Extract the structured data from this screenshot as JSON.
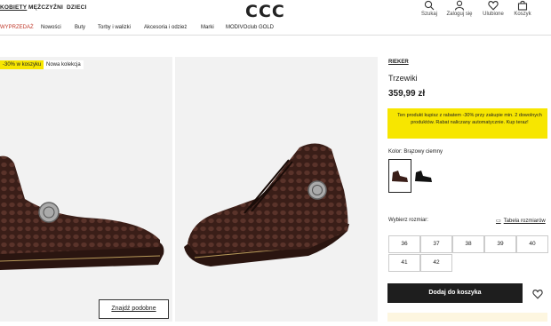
{
  "header": {
    "gender_tabs": [
      "KOBIETY",
      "MĘŻCZYŹNI",
      "DZIECI"
    ],
    "logo": "CCC",
    "tools": [
      {
        "label": "Szukaj",
        "icon": "search-icon"
      },
      {
        "label": "Zaloguj się",
        "icon": "user-icon"
      },
      {
        "label": "Ulubione",
        "icon": "heart-icon"
      },
      {
        "label": "Koszyk",
        "icon": "bag-icon"
      }
    ]
  },
  "nav": {
    "items": [
      "WYPRZEDAŻ",
      "Nowości",
      "Buty",
      "Torby i walizki",
      "Akcesoria i odzież",
      "Marki",
      "MODIVOclub GOLD"
    ],
    "sale_color": "#c0392b"
  },
  "gallery": {
    "badges": [
      "-30% w koszyku",
      "Nowa kolekcja"
    ],
    "badge_color": "#f7e600",
    "find_similar": "Znajdź podobne"
  },
  "product": {
    "brand": "RIEKER",
    "name": "Trzewiki",
    "price": "359,99 zł",
    "promo": "Ten produkt kupisz z rabatem -30% przy zakupie min. 2 dowolnych produktów. Rabat naliczany automatycznie. Kup teraz!",
    "color_label": "Kolor: Brązowy ciemny",
    "size_label": "Wybierz rozmiar:",
    "size_table": "Tabela rozmiarów",
    "sizes": [
      "36",
      "37",
      "38",
      "39",
      "40",
      "41",
      "42"
    ],
    "add_to_cart": "Dodaj do koszyka"
  }
}
